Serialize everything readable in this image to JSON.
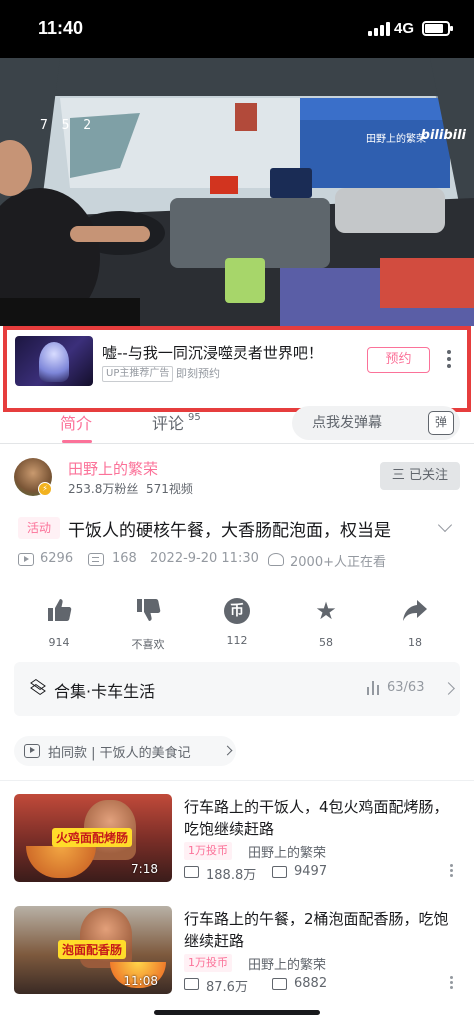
{
  "status_bar": {
    "time": "11:40",
    "network": "4G",
    "battery_percent": 80
  },
  "video": {
    "counter": "7 5 2",
    "uploader_watermark": "田野上的繁荣",
    "logo": "bilibili"
  },
  "ad": {
    "title": "嘘--与我一同沉浸噬灵者世界吧！",
    "tag": "UP主推荐广告",
    "subtitle": "即刻预约",
    "button": "预约"
  },
  "tabs": {
    "intro": "简介",
    "comments": "评论",
    "comments_count": "95",
    "danmaku_placeholder": "点我发弹幕",
    "danmaku_button": "弹"
  },
  "uploader": {
    "name": "田野上的繁荣",
    "fans": "253.8万粉丝",
    "videos": "571视频",
    "follow_label": "三 已关注"
  },
  "video_info": {
    "tag": "活动",
    "title": "干饭人的硬核午餐，大香肠配泡面，权当是",
    "plays": "6296",
    "danmaku": "168",
    "date": "2022-9-20 11:30",
    "watching": "2000+人正在看"
  },
  "actions": {
    "like": {
      "count": "914"
    },
    "dislike": {
      "label": "不喜欢"
    },
    "coin": {
      "count": "112"
    },
    "favorite": {
      "count": "58"
    },
    "share": {
      "count": "18"
    }
  },
  "collection": {
    "title": "合集·卡车生活",
    "progress": "63/63"
  },
  "same_style": {
    "text": "拍同款 | 干饭人的美食记"
  },
  "recommendations": [
    {
      "title": "行车路上的干饭人，4包火鸡面配烤肠，吃饱继续赶路",
      "thumb_label": "火鸡面配烤肠",
      "duration": "7:18",
      "coin_tag": "1万投币",
      "author": "田野上的繁荣",
      "plays": "188.8万",
      "danmaku": "9497"
    },
    {
      "title": "行车路上的午餐，2桶泡面配香肠，吃饱继续赶路",
      "thumb_label": "泡面配香肠",
      "duration": "11:08",
      "coin_tag": "1万投币",
      "author": "田野上的繁荣",
      "plays": "87.6万",
      "danmaku": "6882"
    }
  ],
  "colors": {
    "accent": "#fb7299",
    "highlight_border": "#e63d3d",
    "text": "#18191c",
    "muted": "#9499a0"
  },
  "icons": [
    "signal-icon",
    "battery-icon",
    "thumbs-up-icon",
    "thumbs-down-icon",
    "coin-icon",
    "star-icon",
    "share-icon",
    "collection-icon",
    "play-count-icon",
    "danmaku-count-icon",
    "viewers-icon"
  ]
}
